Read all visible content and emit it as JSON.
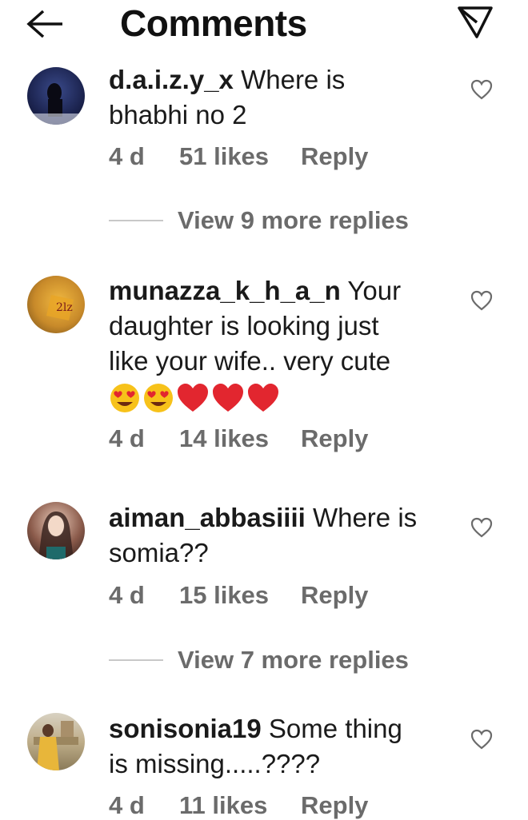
{
  "header": {
    "title": "Comments",
    "back_icon": "arrow-left-icon",
    "send_icon": "paper-plane-icon"
  },
  "comments": [
    {
      "username": "d.a.i.z.y_x",
      "text_line1": " Where is",
      "text_rest": "bhabhi no 2",
      "time": "4 d",
      "likes": "51 likes",
      "reply": "Reply",
      "view_replies": "View 9 more replies"
    },
    {
      "username": "munazza_k_h_a_n",
      "text_line1": " Your",
      "text_line2": "daughter is looking just",
      "text_line3": "like your wife.. very cute",
      "emojis": [
        "😍",
        "😍",
        "❤",
        "❤",
        "❤"
      ],
      "time": "4 d",
      "likes": "14 likes",
      "reply": "Reply"
    },
    {
      "username": "aiman_abbasiiii",
      "text_line1": " Where is",
      "text_rest": "somia??",
      "time": "4 d",
      "likes": "15 likes",
      "reply": "Reply",
      "view_replies": "View 7 more replies"
    },
    {
      "username": "sonisonia19",
      "text_line1": " Some thing",
      "text_rest": "is missing.....????",
      "time": "4 d",
      "likes": "11 likes",
      "reply": "Reply"
    }
  ],
  "colors": {
    "text": "#1a1a1a",
    "meta": "#6b6b6b",
    "heart_red": "#e2262f",
    "emoji_yellow": "#f7c21a"
  }
}
